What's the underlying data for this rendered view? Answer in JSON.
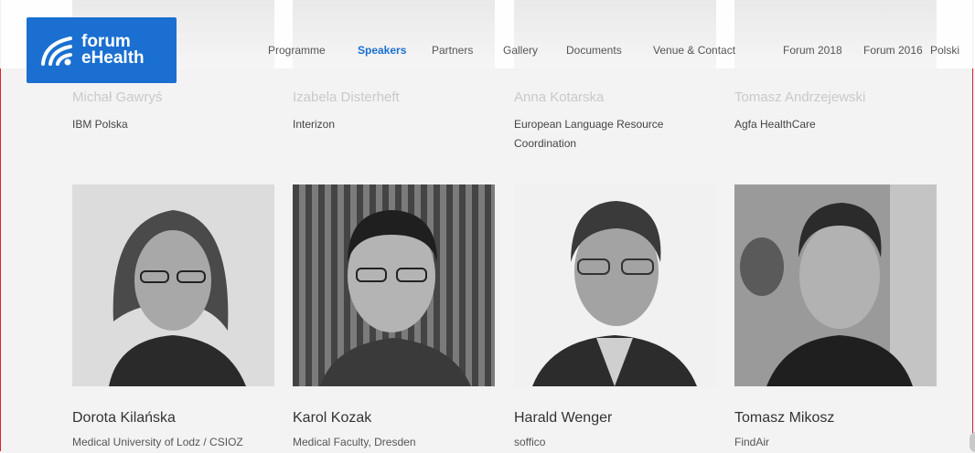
{
  "header": {
    "logo": {
      "line1": "forum",
      "line2": "eHealth"
    },
    "nav": [
      {
        "label": "Programme"
      },
      {
        "label": "Speakers"
      },
      {
        "label": "Partners"
      },
      {
        "label": "Gallery"
      },
      {
        "label": "Documents"
      },
      {
        "label": "Venue & Contact"
      },
      {
        "label": "Forum 2018"
      },
      {
        "label": "Forum 2016"
      },
      {
        "label": "Polski"
      }
    ],
    "active_nav": "Speakers"
  },
  "row1": [
    {
      "name": "Michał Gawryś",
      "org": "IBM Polska"
    },
    {
      "name": "Izabela Disterheft",
      "org": "Interizon"
    },
    {
      "name": "Anna Kotarska",
      "org": "European Language Resource Coordination"
    },
    {
      "name": "Tomasz Andrzejewski",
      "org": "Agfa HealthCare"
    }
  ],
  "row2": [
    {
      "name": "Dorota Kilańska",
      "org": "Medical University of Lodz / CSIOZ"
    },
    {
      "name": "Karol Kozak",
      "org": "Medical Faculty, Dresden"
    },
    {
      "name": "Harald Wenger",
      "org": "soffico"
    },
    {
      "name": "Tomasz Mikosz",
      "org": "FindAir"
    }
  ],
  "colors": {
    "brand": "#1a6fd1",
    "frame": "#d9232e"
  }
}
